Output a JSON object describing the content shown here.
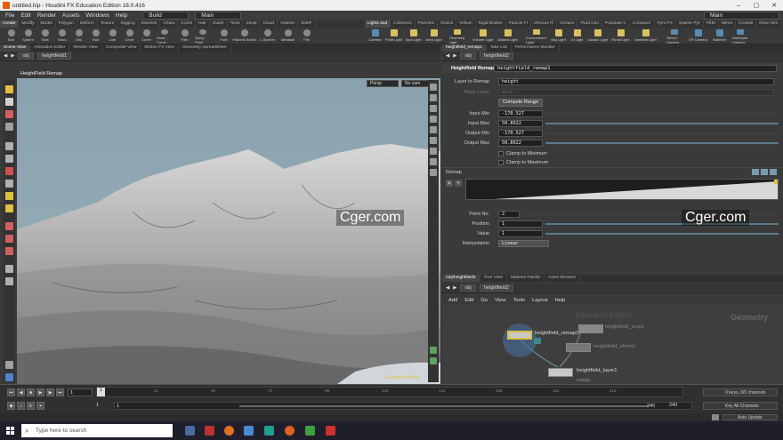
{
  "window": {
    "title": "untitled.hip - Houdini FX Education Edition 18.0.416"
  },
  "menu": {
    "items": [
      "File",
      "Edit",
      "Render",
      "Assets",
      "Windows",
      "Help"
    ],
    "desktop_build": "Build",
    "desktop_main": "Main",
    "right_main": "Main"
  },
  "shelf_tabs_left": [
    "Create",
    "Modify",
    "Model",
    "Polygon",
    "Deform",
    "Texture",
    "Rigging",
    "Muscles",
    "Chara",
    "Const",
    "Hair",
    "Guide",
    "Terra",
    "Simpl",
    "Cloud",
    "Volume",
    "SideF"
  ],
  "shelf_tabs_right": [
    "Lights and",
    "Collisions",
    "Particles",
    "Grains",
    "Vellum",
    "Rigid Bodies",
    "Particle Fl",
    "Viscous Fl",
    "Oceans",
    "Fluid Con",
    "Populate C",
    "Container",
    "Pyro FX",
    "Sparse Pyr",
    "FEM",
    "Wires",
    "Crowds",
    "Drive Sim"
  ],
  "tools_left": [
    "Box",
    "Sphere",
    "Tube",
    "Torus",
    "Grid",
    "Null",
    "Line",
    "Circle",
    "Curve",
    "Draw Curve",
    "Path",
    "Spray Paint",
    "Font",
    "Platonic Solids",
    "L-System",
    "Metaball",
    "File"
  ],
  "tools_right": [
    "Camera",
    "Point Light",
    "Spot Light",
    "Area Light",
    "Geometry Light",
    "Volume Light",
    "Distant Light",
    "Environment Light",
    "Sky Light",
    "GI Light",
    "Caustic Light",
    "Portal Light",
    "Ambient Light",
    "Stereo Camera",
    "VR Camera",
    "Switcher",
    "Gamepad Camera"
  ],
  "left_pane_tabs": [
    "Scene View",
    "Animation Editor",
    "Render View",
    "Composite View",
    "Motion FX View",
    "Geometry Spreadsheet"
  ],
  "right_pane_tabs": [
    "heightfield_remap1",
    "Take List",
    "Performance Monitor"
  ],
  "viewport": {
    "path_root": "obj",
    "path_node": "heightfield1",
    "header": "HeightField Remap",
    "persp": "Persp",
    "cam": "No cam",
    "edition": "Education Edition"
  },
  "params": {
    "path_root": "obj",
    "path_node": "heightfield2",
    "node_type": "Heightfield Remap",
    "node_name": "heightfield_remap1",
    "layer_label": "Layer to Remap",
    "layer_value": "height",
    "mask_label": "Mask Layer",
    "mask_value": "mask",
    "compute_label": "Compute Range",
    "input_min_label": "Input Min",
    "input_min": "-170.527",
    "input_max_label": "Input Max",
    "input_max": "50.8922",
    "output_min_label": "Output Min",
    "output_min": "-170.527",
    "output_max_label": "Output Max",
    "output_max": "50.8922",
    "clamp_min": "Clamp to Minimum",
    "clamp_max": "Clamp to Maximum",
    "remap_label": "Remap",
    "point_label": "Point No.",
    "point_value": "2",
    "position_label": "Position",
    "position_value": "1",
    "value_label": "Value",
    "value_value": "1",
    "interp_label": "Interpolation",
    "interp_value": "Linear"
  },
  "network": {
    "tabs": [
      "/obj/heightfield2",
      "Tree View",
      "Material Palette",
      "Asset Browser"
    ],
    "path_root": "obj",
    "path_node": "heightfield2",
    "menu": [
      "Add",
      "Edit",
      "Go",
      "View",
      "Tools",
      "Layout",
      "Help"
    ],
    "watermark": "Education Edition",
    "context": "Geometry",
    "nodes": {
      "remap": "heightfield_remap1",
      "crop": "heightfield_crop1",
      "xform": "heightfield_xform1",
      "layer": "heightfield_layer1",
      "layer_sub": "multiply"
    }
  },
  "playbar": {
    "frame": "1",
    "start": "1",
    "start2": "1",
    "end": "240",
    "end2": "240",
    "ticks": [
      "24",
      "48",
      "72",
      "96",
      "120",
      "144",
      "168",
      "192",
      "216"
    ],
    "keys": "0 keys, 0/0 channels",
    "key_all": "Key All Channels",
    "auto_update": "Auto Update"
  },
  "taskbar": {
    "search_placeholder": "Type here to search"
  },
  "watermarks": [
    "Cger.com",
    "Cger.com"
  ]
}
